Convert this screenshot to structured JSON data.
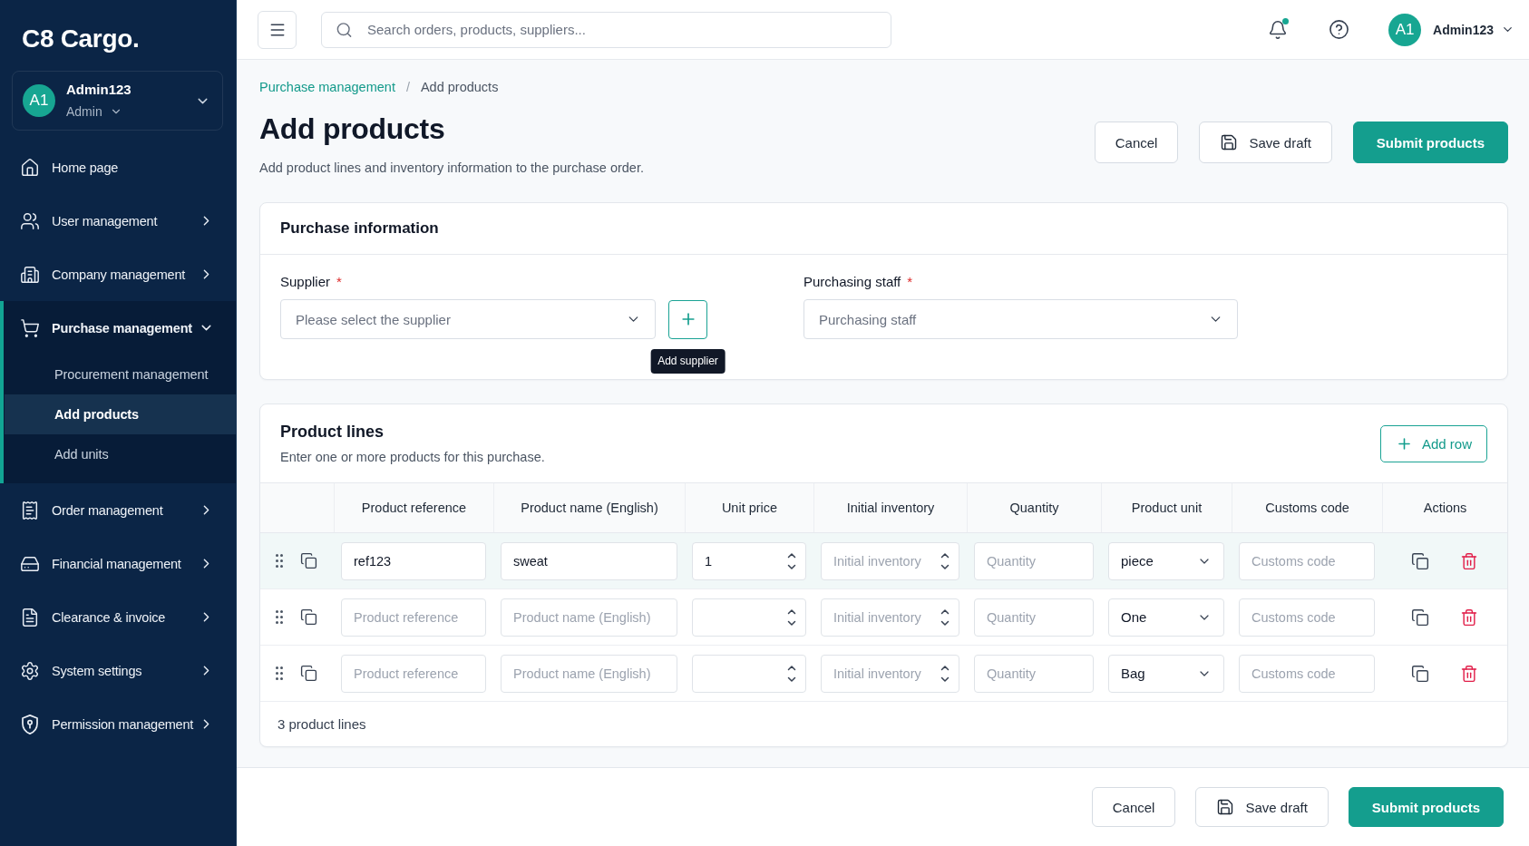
{
  "sidebar": {
    "logo": "C8 Cargo.",
    "account": {
      "initials": "A1",
      "name": "Admin123",
      "role": "Admin"
    },
    "nav": [
      {
        "label": "Home page",
        "selected": false
      },
      {
        "label": "User management",
        "selected": false,
        "expanded": false
      },
      {
        "label": "Company management",
        "selected": false,
        "expanded": false
      },
      {
        "label": "Purchase management",
        "selected": true,
        "expanded": true,
        "children": [
          {
            "label": "Procurement management",
            "selected": false
          },
          {
            "label": "Add products",
            "selected": true
          },
          {
            "label": "Add units",
            "selected": false
          }
        ]
      },
      {
        "label": "Order management",
        "selected": false,
        "expanded": false
      },
      {
        "label": "Financial management",
        "selected": false,
        "expanded": false
      },
      {
        "label": "Clearance & invoice",
        "selected": false,
        "expanded": false
      },
      {
        "label": "System settings",
        "selected": false,
        "expanded": false
      },
      {
        "label": "Permission management",
        "selected": false,
        "expanded": false
      }
    ]
  },
  "top_bar": {
    "search": {
      "placeholder": "Search orders, products, suppliers..."
    },
    "notifications": {
      "unread": true
    },
    "user": {
      "initials": "A1",
      "name": "Admin123"
    }
  },
  "page": {
    "breadcrumb": {
      "separator": "/",
      "items": [
        {
          "label": "Purchase management",
          "kind": "link"
        },
        {
          "label": "Add products",
          "kind": "current"
        }
      ]
    },
    "title": "Add products",
    "subtitle": "Add product lines and inventory information to the purchase order.",
    "actions": [
      {
        "label": "Cancel",
        "kind": "outline"
      },
      {
        "label": "Save draft",
        "kind": "save"
      },
      {
        "label": "Submit products",
        "kind": "primary"
      }
    ]
  },
  "purchase_information": {
    "title": "Purchase information",
    "fields": [
      {
        "label": "Supplier",
        "required_mark": "*",
        "placeholder": "Please select the supplier",
        "add_button": {
          "tooltip": "Add supplier"
        }
      },
      {
        "label": "Purchasing staff",
        "required_mark": "*",
        "placeholder": "Purchasing staff"
      }
    ]
  },
  "product_lines": {
    "title": "Product lines",
    "subtitle": "Enter one or more products for this purchase.",
    "add_button": "Add row",
    "columns": [
      "Product reference",
      "Product name (English)",
      "Unit price",
      "Initial inventory",
      "Quantity",
      "Product unit",
      "Customs code",
      "Actions"
    ],
    "rows": [
      {
        "selected": true,
        "reference": {
          "value": "ref123"
        },
        "name": {
          "value": "sweat"
        },
        "unit_price": {
          "value": "1"
        },
        "initial_inventory": {
          "placeholder": "Initial inventory"
        },
        "quantity": {
          "placeholder": "Quantity"
        },
        "unit": "piece",
        "customs_code": {
          "placeholder": "Customs code"
        }
      },
      {
        "selected": false,
        "reference": {
          "placeholder": "Product reference"
        },
        "name": {
          "placeholder": "Product name (English)"
        },
        "initial_inventory": {
          "placeholder": "Initial inventory"
        },
        "quantity": {
          "placeholder": "Quantity"
        },
        "unit": "One",
        "customs_code": {
          "placeholder": "Customs code"
        }
      },
      {
        "selected": false,
        "reference": {
          "placeholder": "Product reference"
        },
        "name": {
          "placeholder": "Product name (English)"
        },
        "initial_inventory": {
          "placeholder": "Initial inventory"
        },
        "quantity": {
          "placeholder": "Quantity"
        },
        "unit": "Bag",
        "customs_code": {
          "placeholder": "Customs code"
        }
      }
    ],
    "count": "3 product lines"
  },
  "footer_actions": [
    {
      "label": "Cancel",
      "kind": "outline"
    },
    {
      "label": "Save draft",
      "kind": "save"
    },
    {
      "label": "Submit products",
      "kind": "primary"
    }
  ]
}
